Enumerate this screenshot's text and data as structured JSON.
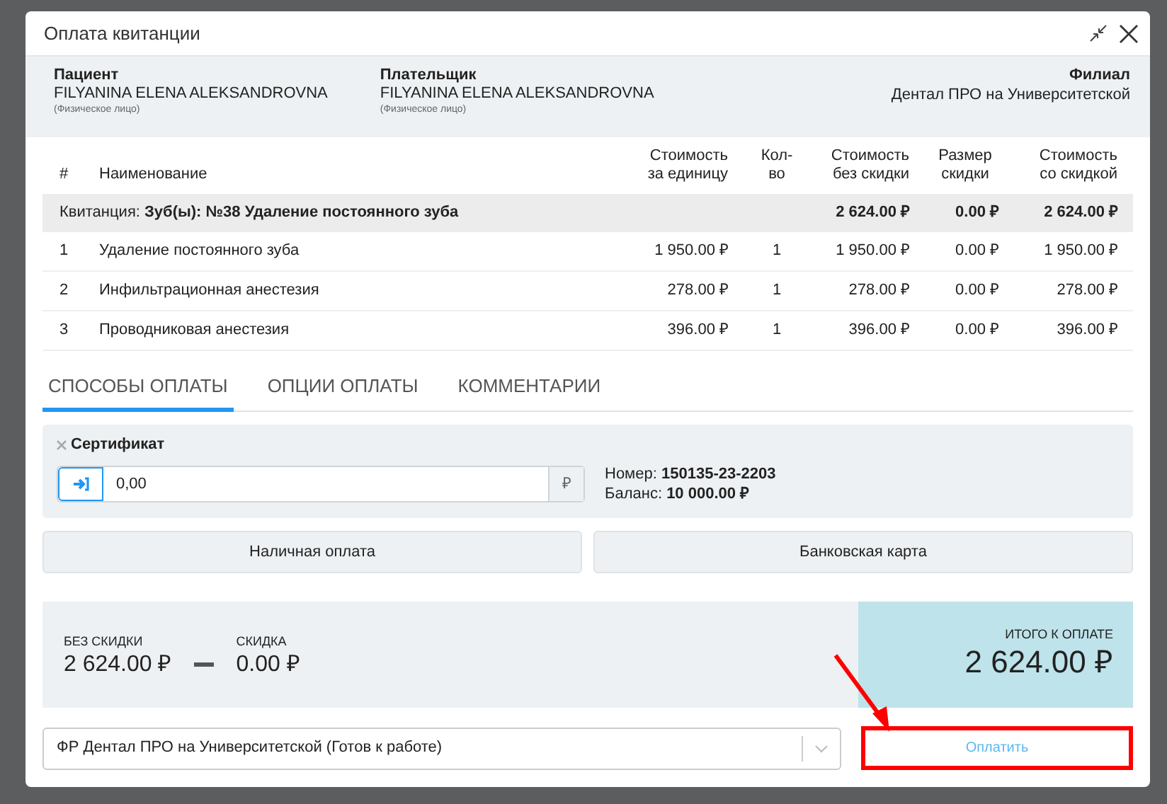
{
  "dialog": {
    "title": "Оплата квитанции"
  },
  "parties": [
    {
      "label": "Пациент",
      "name": "FILYANINA ELENA ALEKSANDROVNA",
      "note": "(Физическое лицо)"
    },
    {
      "label": "Плательщик",
      "name": "FILYANINA ELENA ALEKSANDROVNA",
      "note": "(Физическое лицо)"
    }
  ],
  "branch": {
    "label": "Филиал",
    "name": "Дентал ПРО на Университетской"
  },
  "table": {
    "columns": [
      "#",
      "Наименование",
      "Стоимость за единицу",
      "Кол-во",
      "Стоимость без скидки",
      "Размер скидки",
      "Стоимость со скидкой"
    ],
    "group": {
      "label": "Квитанция: **Зуб(ы): №38 Удаление постоянного зуба**",
      "cells": [
        "2 624.00 ₽",
        "0.00 ₽",
        "2 624.00 ₽"
      ]
    },
    "rows": [
      [
        "1",
        "Удаление постоянного зуба",
        "1 950.00 ₽",
        "1",
        "1 950.00 ₽",
        "0.00 ₽",
        "1 950.00 ₽"
      ],
      [
        "2",
        "Инфильтрационная анестезия",
        "278.00 ₽",
        "1",
        "278.00 ₽",
        "0.00 ₽",
        "278.00 ₽"
      ],
      [
        "3",
        "Проводниковая анестезия",
        "396.00 ₽",
        "1",
        "396.00 ₽",
        "0.00 ₽",
        "396.00 ₽"
      ]
    ]
  },
  "tabs": [
    {
      "label": "СПОСОБЫ ОПЛАТЫ",
      "selected": true
    },
    {
      "label": "ОПЦИИ ОПЛАТЫ",
      "selected": false
    },
    {
      "label": "КОММЕНТАРИИ",
      "selected": false
    }
  ],
  "certificate": {
    "title": "Сертификат",
    "value": "0,00",
    "currency": "₽",
    "number": "Номер: **150135-23-2203**",
    "balance": "Баланс: **10 000.00 ₽**"
  },
  "payment_methods": [
    "Наличная оплата",
    "Банковская карта"
  ],
  "summary": {
    "subtotal_label": "БЕЗ СКИДКИ",
    "subtotal": "2 624.00 ₽",
    "discount_label": "СКИДКА",
    "discount": "0.00 ₽",
    "total_label": "ИТОГО К ОПЛАТЕ",
    "total": "2 624.00 ₽"
  },
  "terminal": {
    "value": "ФР Дентал ПРО на Университетской (Готов к работе)"
  },
  "pay_button": "Оплатить"
}
